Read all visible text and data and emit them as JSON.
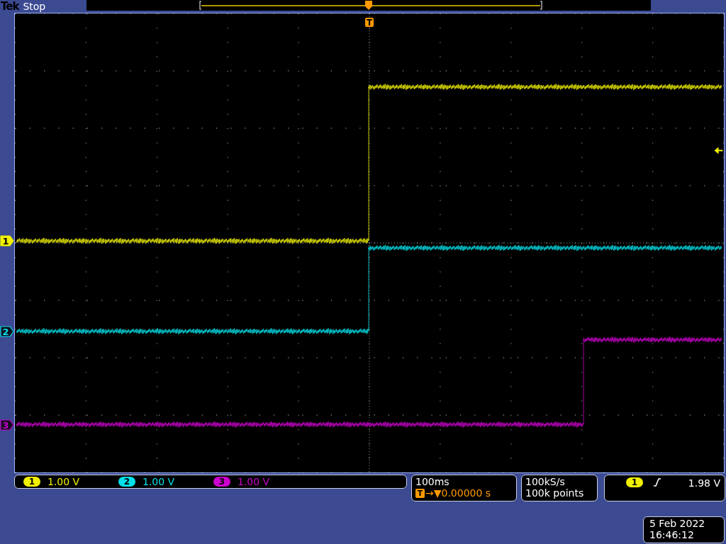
{
  "header": {
    "brand": "Tek",
    "status": "Stop"
  },
  "trigger_marker": "T",
  "channels": [
    {
      "marker": "1",
      "number": "1",
      "scale": "1.00 V",
      "color": "#f0f000",
      "selected": true
    },
    {
      "marker": "2",
      "number": "2",
      "scale": "1.00 V",
      "color": "#00e0e8",
      "selected": false
    },
    {
      "marker": "3",
      "number": "3",
      "scale": "1.00 V",
      "color": "#cc00cc",
      "selected": false
    }
  ],
  "timebase": {
    "scale": "100ms",
    "position_icon": "T",
    "position": "→▼0.00000 s"
  },
  "acquisition": {
    "sample_rate": "100kS/s",
    "record_length": "100k points"
  },
  "trigger": {
    "source": "1",
    "level": "1.98 V"
  },
  "timestamp": {
    "date": "5 Feb  2022",
    "time": "16:46:12"
  }
}
